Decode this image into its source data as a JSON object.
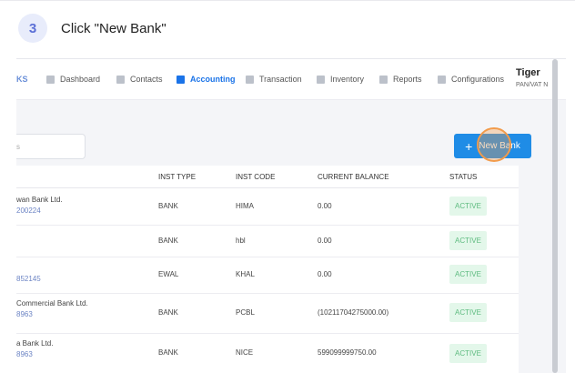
{
  "step": {
    "number": "3",
    "instruction": "Click \"New Bank\""
  },
  "nav": {
    "logo_fragment": "KS",
    "items": [
      {
        "label": "Dashboard",
        "icon": "dashboard-icon",
        "active": false
      },
      {
        "label": "Contacts",
        "icon": "contacts-icon",
        "active": false
      },
      {
        "label": "Accounting",
        "icon": "accounting-icon",
        "active": true
      },
      {
        "label": "Transaction",
        "icon": "transaction-icon",
        "active": false
      },
      {
        "label": "Inventory",
        "icon": "inventory-icon",
        "active": false
      },
      {
        "label": "Reports",
        "icon": "reports-icon",
        "active": false
      },
      {
        "label": "Configurations",
        "icon": "configurations-icon",
        "active": false
      }
    ],
    "user": {
      "name": "Tiger",
      "sub": "PAN/VAT N"
    }
  },
  "toolbar": {
    "search_value": "s",
    "new_button_label": "New Bank",
    "new_button_icon": "plus-icon"
  },
  "table": {
    "columns": [
      "INST TYPE",
      "INST CODE",
      "CURRENT BALANCE",
      "STATUS"
    ],
    "rows": [
      {
        "name": "wan Bank Ltd.",
        "code_number": "200224",
        "type": "BANK",
        "code": "HIMA",
        "balance": "0.00",
        "status": "ACTIVE"
      },
      {
        "name": "",
        "code_number": "",
        "type": "BANK",
        "code": "hbl",
        "balance": "0.00",
        "status": "ACTIVE"
      },
      {
        "name": "",
        "code_number": "852145",
        "type": "EWAL",
        "code": "KHAL",
        "balance": "0.00",
        "status": "ACTIVE"
      },
      {
        "name": "Commercial Bank Ltd.",
        "code_number": "8963",
        "type": "BANK",
        "code": "PCBL",
        "balance": "(10211704275000.00)",
        "status": "ACTIVE"
      },
      {
        "name": "a Bank Ltd.",
        "code_number": "8963",
        "type": "BANK",
        "code": "NICE",
        "balance": "599099999750.00",
        "status": "ACTIVE"
      }
    ]
  },
  "colors": {
    "accent": "#1f8ce6",
    "active_nav": "#1a73e8",
    "status_bg": "#e3f7ea",
    "status_text": "#5dbb7f",
    "click_indicator": "#f29b4b"
  }
}
